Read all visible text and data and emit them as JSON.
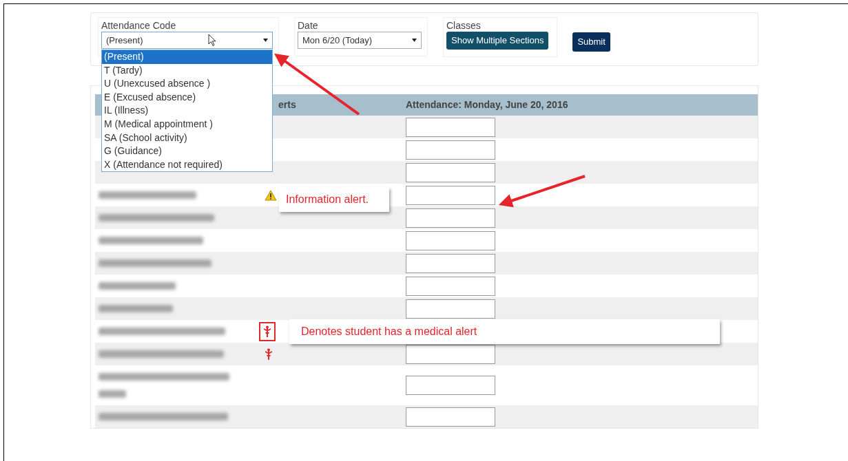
{
  "filters": [
    {
      "label": "Attendance Code",
      "kind": "select",
      "value": "(Present)",
      "expanded": true
    },
    {
      "label": "Date",
      "kind": "select",
      "value": "Mon 6/20 (Today)",
      "expanded": false
    },
    {
      "label": "Classes",
      "kind": "button",
      "value": "Show Multiple Sections",
      "expanded": false
    }
  ],
  "submit": "Submit",
  "dropdown_options": [
    {
      "label": "(Present)",
      "selected": true
    },
    {
      "label": "T (Tardy)",
      "selected": false
    },
    {
      "label": "U (Unexcused absence )",
      "selected": false
    },
    {
      "label": "E (Excused absence)",
      "selected": false
    },
    {
      "label": "IL (Illness)",
      "selected": false
    },
    {
      "label": "M (Medical appointment )",
      "selected": false
    },
    {
      "label": "SA (School activity)",
      "selected": false
    },
    {
      "label": "G (Guidance)",
      "selected": false
    },
    {
      "label": "X (Attendance not required)",
      "selected": false
    }
  ],
  "table": {
    "columns": [
      "erts",
      "Attendance: Monday, June 20, 2016"
    ],
    "rows": [
      {
        "name_hidden": true,
        "name_wrapped": false,
        "info_alert": false,
        "medical_alert": false
      },
      {
        "name_hidden": true,
        "name_wrapped": false,
        "info_alert": false,
        "medical_alert": false
      },
      {
        "name_hidden": true,
        "name_wrapped": false,
        "info_alert": false,
        "medical_alert": false
      },
      {
        "name_hidden": false,
        "name_wrapped": false,
        "info_alert": true,
        "medical_alert": false,
        "callout": {
          "text": "Information alert.",
          "covers_input": false
        }
      },
      {
        "name_hidden": false,
        "name_wrapped": false,
        "info_alert": false,
        "medical_alert": false
      },
      {
        "name_hidden": false,
        "name_wrapped": false,
        "info_alert": false,
        "medical_alert": false
      },
      {
        "name_hidden": false,
        "name_wrapped": false,
        "info_alert": false,
        "medical_alert": false
      },
      {
        "name_hidden": false,
        "name_wrapped": false,
        "info_alert": false,
        "medical_alert": false
      },
      {
        "name_hidden": false,
        "name_wrapped": false,
        "info_alert": false,
        "medical_alert": false
      },
      {
        "name_hidden": false,
        "name_wrapped": false,
        "info_alert": false,
        "medical_alert": true,
        "highlighted": true,
        "callout": {
          "text": "Denotes student has a medical alert",
          "covers_input": true
        }
      },
      {
        "name_hidden": false,
        "name_wrapped": false,
        "info_alert": false,
        "medical_alert": true,
        "highlighted": false
      },
      {
        "name_hidden": false,
        "name_wrapped": true,
        "info_alert": false,
        "medical_alert": false
      },
      {
        "name_hidden": false,
        "name_wrapped": false,
        "info_alert": false,
        "medical_alert": false
      }
    ]
  }
}
